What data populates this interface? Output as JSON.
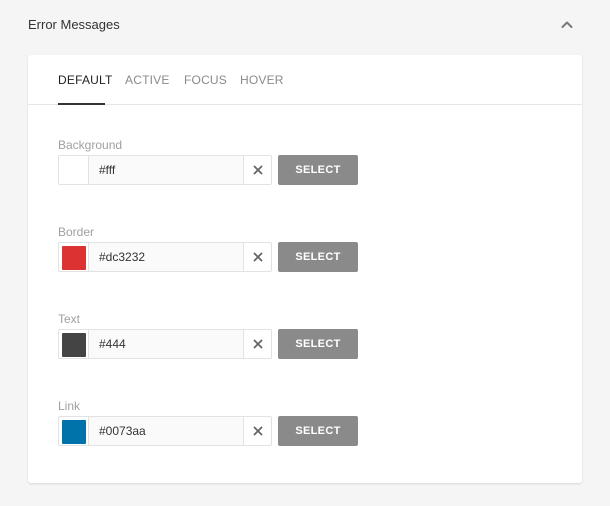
{
  "panel": {
    "title": "Error Messages",
    "collapse_icon": "chevron-up-icon"
  },
  "tabs": [
    {
      "label": "DEFAULT",
      "active": true
    },
    {
      "label": "ACTIVE",
      "active": false
    },
    {
      "label": "FOCUS",
      "active": false
    },
    {
      "label": "HOVER",
      "active": false
    }
  ],
  "fields": [
    {
      "label": "Background",
      "value": "#fff",
      "swatch_color": "#ffffff",
      "select_label": "SELECT",
      "clear_icon": "close-icon"
    },
    {
      "label": "Border",
      "value": "#dc3232",
      "swatch_color": "#dc3232",
      "select_label": "SELECT",
      "clear_icon": "close-icon"
    },
    {
      "label": "Text",
      "value": "#444",
      "swatch_color": "#444444",
      "select_label": "SELECT",
      "clear_icon": "close-icon"
    },
    {
      "label": "Link",
      "value": "#0073aa",
      "swatch_color": "#0073aa",
      "select_label": "SELECT",
      "clear_icon": "close-icon"
    }
  ],
  "colors": {
    "page_background": "#f5f5f5",
    "card_background": "#ffffff",
    "select_button": "#8a8a8a",
    "tab_active_underline": "#333333"
  }
}
